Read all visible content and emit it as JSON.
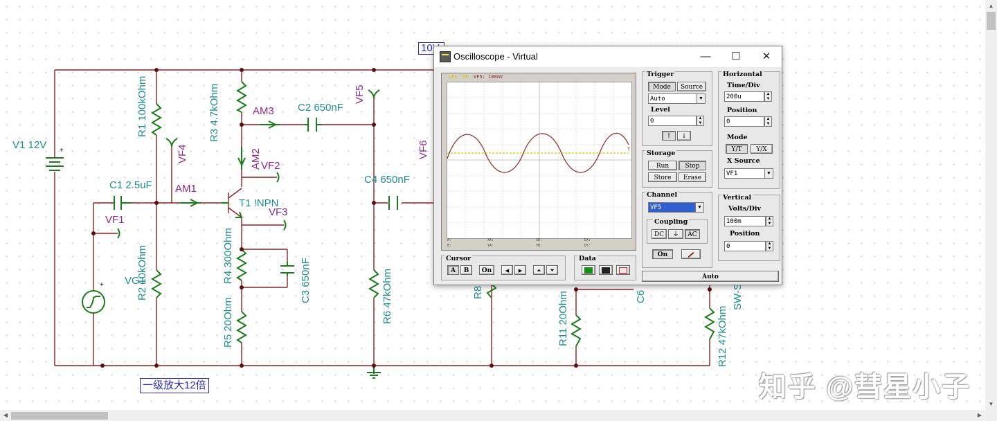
{
  "schematic": {
    "labels": {
      "v1": "V1 12V",
      "r1": "R1 100kOhm",
      "r2": "R2 10kOhm",
      "r3": "R3 4.7kOhm",
      "r4": "R4 300Ohm",
      "r5": "R5 20Ohm",
      "r6": "R6 47kOhm",
      "r8": "R8",
      "r11": "R11 20Ohm",
      "r12": "R12 47kOhm",
      "c1": "C1 2.5uF",
      "c2": "C2 650nF",
      "c3": "C3 650nF",
      "c4": "C4 650nF",
      "c6": "C6",
      "t1": "T1 !NPN",
      "am1": "AM1",
      "am2": "AM2",
      "am3": "AM3",
      "vf1": "VF1",
      "vf2": "VF2",
      "vf3": "VF3",
      "vf4": "VF4",
      "vf5": "VF5",
      "vf6": "VF6",
      "vg1": "VG1",
      "sw": "SW-S",
      "plus": "+"
    },
    "stage_label": "一级放大12倍",
    "top_note": "10V"
  },
  "watermark": "知乎 @彗星小子",
  "oscilloscope": {
    "title": "Oscilloscope - Virtual",
    "window_buttons": {
      "minimize": "—",
      "maximize": "☐",
      "close": "✕"
    },
    "screen": {
      "legend_a": "VF1",
      "legend_b": "VF",
      "legend_c": "VF5: 100mV",
      "trig_marker": "T",
      "readouts": {
        "a": "A:",
        "b": "B:",
        "xa": "XA:",
        "ya": "YA:",
        "xb": "XB:",
        "yb": "YB:",
        "dx": "DX:",
        "dy": "DY:"
      }
    },
    "trigger": {
      "title": "Trigger",
      "mode_label": "Mode",
      "source_label": "Source",
      "mode_value": "Auto",
      "level_label": "Level",
      "level_value": "0",
      "rise_icon": "rising-edge-icon",
      "fall_icon": "falling-edge-icon"
    },
    "horizontal": {
      "title": "Horizontal",
      "time_div_label": "Time/Div",
      "time_div_value": "200u",
      "position_label": "Position",
      "position_value": "0",
      "mode_label": "Mode",
      "yt_label": "Y/T",
      "yx_label": "Y/X",
      "xsource_label": "X Source",
      "xsource_value": "VF1"
    },
    "storage": {
      "title": "Storage",
      "run": "Run",
      "stop": "Stop",
      "store": "Store",
      "erase": "Erase"
    },
    "channel": {
      "title": "Channel",
      "value": "VF5",
      "coupling_label": "Coupling",
      "dc": "DC",
      "gnd": "⏚",
      "ac": "AC",
      "on": "On"
    },
    "vertical": {
      "title": "Vertical",
      "volts_div_label": "Volts/Div",
      "volts_div_value": "100m",
      "position_label": "Position",
      "position_value": "0"
    },
    "cursor": {
      "title": "Cursor",
      "a": "A",
      "b": "B",
      "on": "On",
      "left": "◀",
      "right": "▶",
      "up": "⏶",
      "down": "⏷"
    },
    "data": {
      "title": "Data"
    },
    "auto": "Auto"
  }
}
